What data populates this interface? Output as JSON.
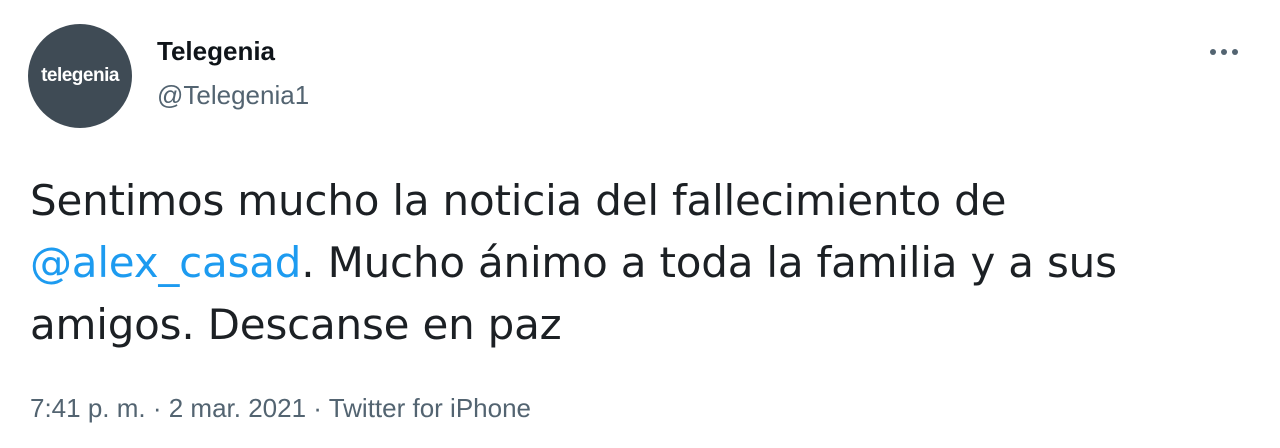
{
  "author": {
    "avatar_text": "telegenia",
    "avatar_color": "#3f4b55",
    "display_name": "Telegenia",
    "handle": "@Telegenia1"
  },
  "more_icon": "more-horizontal-icon",
  "tweet": {
    "text_before": "Sentimos mucho la noticia del fallecimiento de ",
    "mention": "@alex_casad",
    "text_after": ". Mucho ánimo a toda la familia y a sus amigos. Descanse en paz"
  },
  "meta": {
    "time": "7:41 p. m.",
    "separator_1": " · ",
    "date": "2 mar. 2021",
    "separator_2": " · ",
    "source": "Twitter for iPhone"
  },
  "colors": {
    "link": "#1d9bf0",
    "secondary_text": "#536471",
    "primary_text": "#0f1419"
  }
}
